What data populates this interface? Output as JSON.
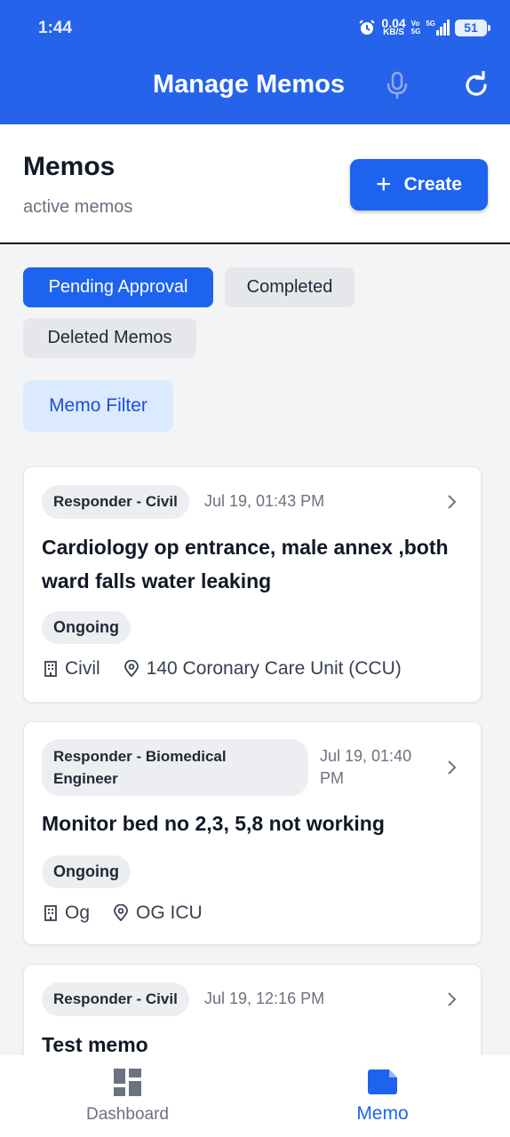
{
  "status_bar": {
    "time": "1:44",
    "net_speed_value": "0.04",
    "net_speed_unit": "KB/S",
    "volte_top": "Vo",
    "volte_bottom": "5G",
    "network": "5G",
    "battery": "51"
  },
  "app_bar": {
    "title": "Manage Memos",
    "icons": [
      "mic-icon",
      "refresh-icon"
    ]
  },
  "page": {
    "title": "Memos",
    "subtitle": "active memos",
    "create_label": "Create"
  },
  "tabs": [
    {
      "label": "Pending Approval",
      "active": true
    },
    {
      "label": "Completed",
      "active": false
    },
    {
      "label": "Deleted Memos",
      "active": false
    }
  ],
  "filter_label": "Memo Filter",
  "memos": [
    {
      "responder": "Responder - Civil",
      "time": "Jul 19, 01:43 PM",
      "title": "Cardiology op entrance, male annex ,both ward falls water leaking",
      "status": "Ongoing",
      "department": "Civil",
      "location": "140 Coronary Care Unit (CCU)"
    },
    {
      "responder_line1": "Responder - Biomedical",
      "responder_line2": "Engineer",
      "time_line1": "Jul 19, 01:40",
      "time_line2": "PM",
      "title": "Monitor bed no 2,3, 5,8 not working",
      "status": "Ongoing",
      "department": "Og",
      "location": "OG ICU"
    },
    {
      "responder": "Responder - Civil",
      "time": "Jul 19, 12:16 PM",
      "title": "Test memo"
    }
  ],
  "bottom_nav": [
    {
      "label": "Dashboard",
      "active": false,
      "icon": "dashboard-icon"
    },
    {
      "label": "Memo",
      "active": true,
      "icon": "memo-icon"
    }
  ],
  "colors": {
    "primary": "#2563eb",
    "active_nav": "#1d63f0",
    "inactive_nav": "#6b7280"
  }
}
